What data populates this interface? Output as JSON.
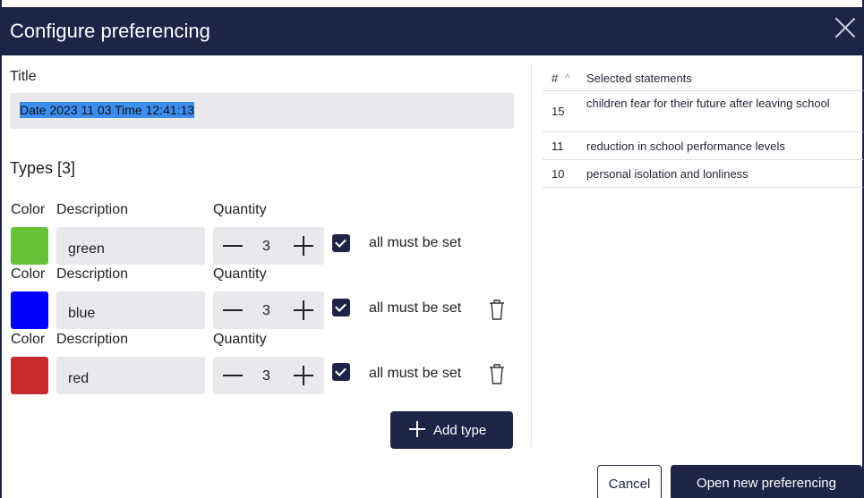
{
  "dialog": {
    "title": "Configure preferencing",
    "close_icon": "close-icon"
  },
  "form": {
    "title_label": "Title",
    "title_value": "Date 2023 11 03 Time 12:41:13",
    "types_heading": "Types [3]"
  },
  "columns": {
    "color": "Color",
    "description": "Description",
    "quantity": "Quantity"
  },
  "types": [
    {
      "color": "#67c23a",
      "description": "green",
      "quantity": "3",
      "must_label": "all must be set",
      "checked": true,
      "deletable": false
    },
    {
      "color": "#0000ff",
      "description": "blue",
      "quantity": "3",
      "must_label": "all must be set",
      "checked": true,
      "deletable": true
    },
    {
      "color": "#c62a2f",
      "description": "red",
      "quantity": "3",
      "must_label": "all must be set",
      "checked": true,
      "deletable": true
    }
  ],
  "add_type_label": "Add type",
  "statements": {
    "header_num": "#",
    "sort_icon": "^",
    "header_text": "Selected statements",
    "rows": [
      {
        "num": "15",
        "text": "children fear for their future after leaving school"
      },
      {
        "num": "11",
        "text": "reduction in school performance levels"
      },
      {
        "num": "10",
        "text": "personal isolation and lonliness"
      }
    ]
  },
  "footer": {
    "cancel_label": "Cancel",
    "open_label": "Open new preferencing"
  },
  "colors": {
    "accent": "#1e2447",
    "field_bg": "#e8e9ec",
    "selection": "#3b8ef0"
  }
}
